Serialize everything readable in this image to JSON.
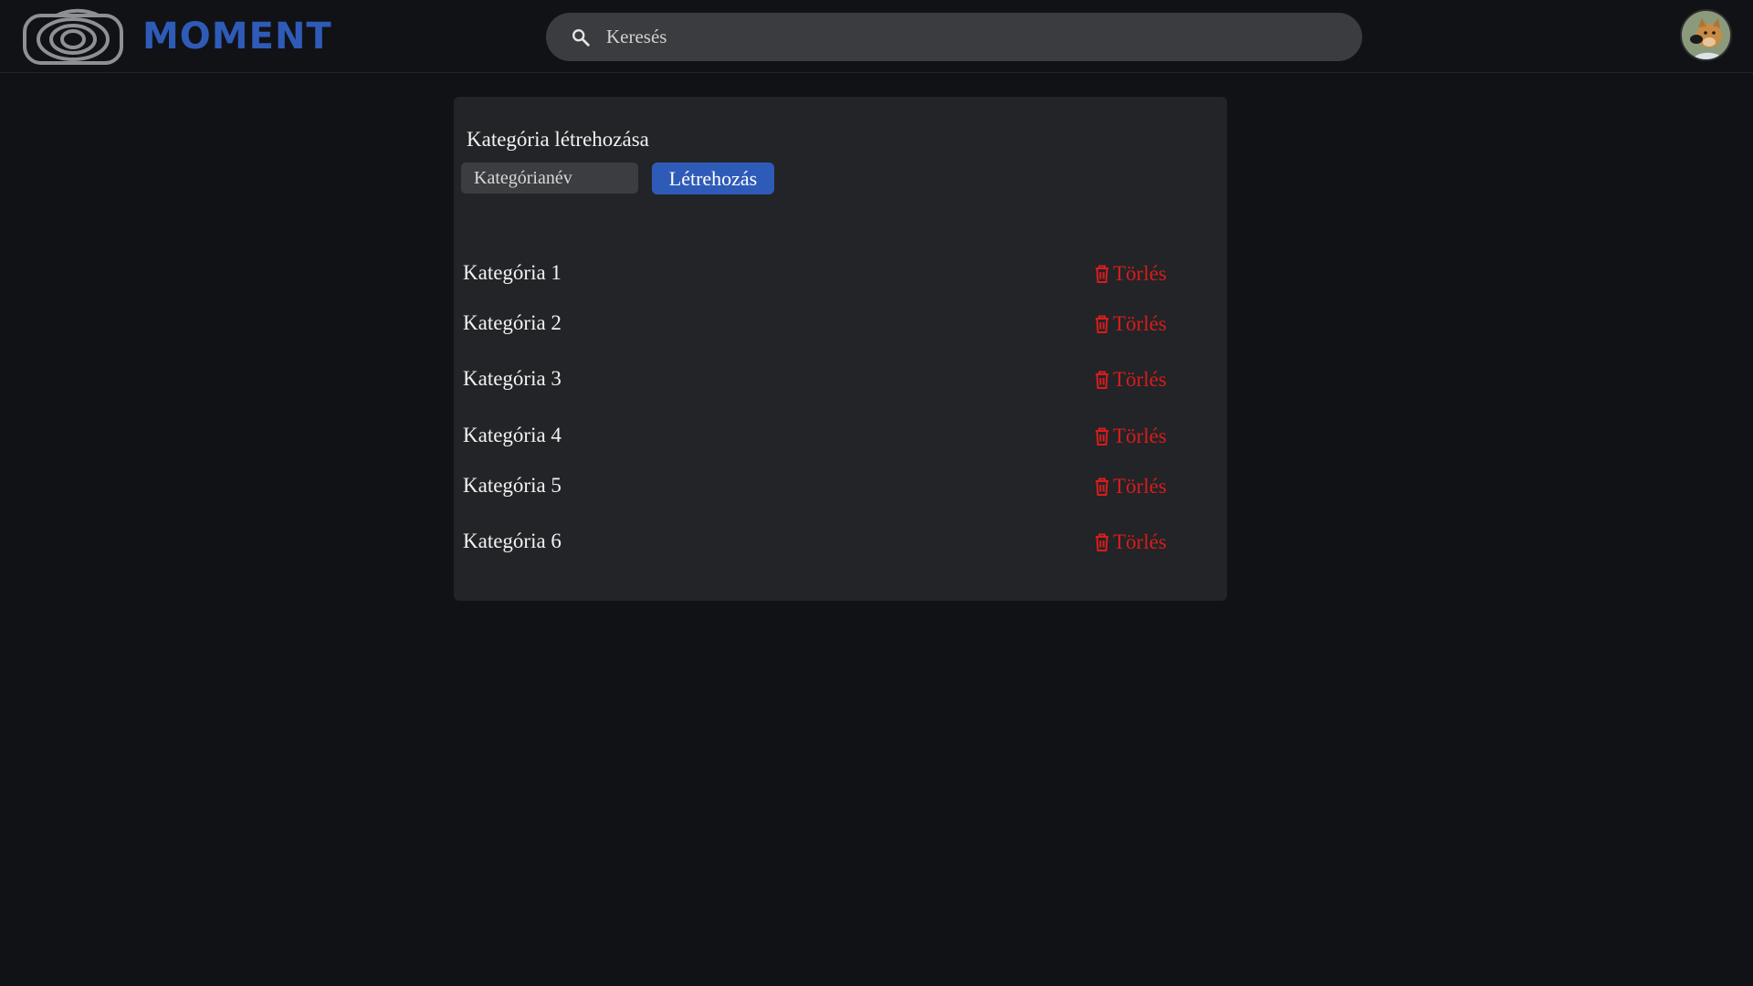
{
  "header": {
    "brand": "MOMENT",
    "search_placeholder": "Keresés",
    "logo_icon": "moment-logo-icon",
    "search_icon": "search-icon",
    "avatar_icon": "user-avatar-dog",
    "colors": {
      "brand": "#2f5bb8",
      "background": "#111216"
    }
  },
  "panel": {
    "title": "Kategória létrehozása",
    "input_placeholder": "Kategórianév",
    "create_label": "Létrehozás"
  },
  "categories": [
    {
      "name": "Kategória 1",
      "delete_label": "Törlés"
    },
    {
      "name": "Kategória 2",
      "delete_label": "Törlés"
    },
    {
      "name": "Kategória 3",
      "delete_label": "Törlés"
    },
    {
      "name": "Kategória 4",
      "delete_label": "Törlés"
    },
    {
      "name": "Kategória 5",
      "delete_label": "Törlés"
    },
    {
      "name": "Kategória 6",
      "delete_label": "Törlés"
    }
  ],
  "colors": {
    "delete": "#d81c1c",
    "button": "#2f5bb8",
    "panel": "#232427"
  }
}
